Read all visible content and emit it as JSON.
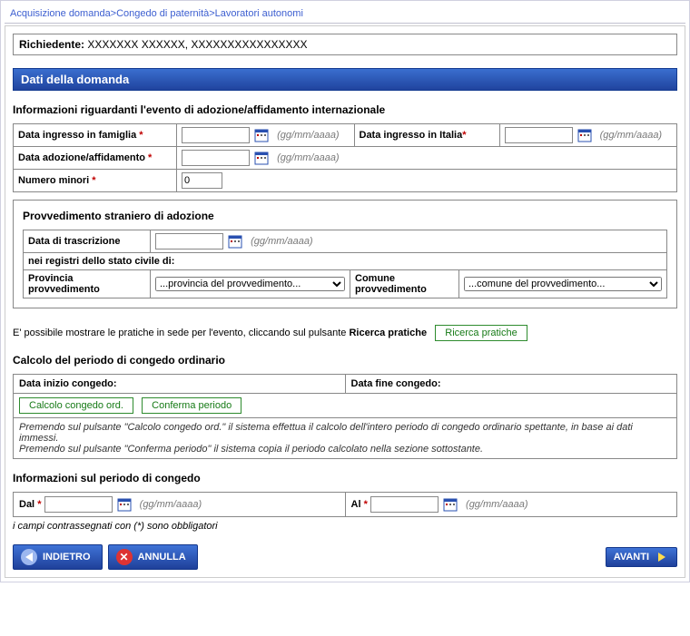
{
  "breadcrumb": "Acquisizione domanda>Congedo di paternità>Lavoratori autonomi",
  "richiedente": {
    "label": "Richiedente:",
    "value": "XXXXXXX XXXXXX, XXXXXXXXXXXXXXXX"
  },
  "section_title": "Dati della domanda",
  "evento": {
    "heading": "Informazioni riguardanti l'evento di adozione/affidamento internazionale",
    "row1": {
      "lbl_ingresso_famiglia": "Data ingresso in famiglia",
      "lbl_ingresso_italia": "Data ingresso in Italia"
    },
    "row2": {
      "lbl_adozione": "Data adozione/affidamento"
    },
    "row3": {
      "lbl_numero": "Numero minori",
      "value": "0"
    },
    "hint": "(gg/mm/aaaa)"
  },
  "provv": {
    "heading": "Provvedimento straniero di adozione",
    "lbl_trascrizione": "Data di trascrizione",
    "lbl_registri": "nei registri dello stato civile di:",
    "lbl_provincia": "Provincia provvedimento",
    "sel_provincia": "...provincia del provvedimento...",
    "lbl_comune": "Comune provvedimento",
    "sel_comune": "...comune del provvedimento..."
  },
  "ricerca": {
    "text_a": "E' possibile mostrare le pratiche in sede per l'evento, cliccando sul pulsante ",
    "text_b": "Ricerca pratiche",
    "btn": "Ricerca pratiche"
  },
  "calcolo": {
    "heading": "Calcolo del periodo di congedo ordinario",
    "lbl_inizio": "Data inizio congedo:",
    "lbl_fine": "Data fine congedo:",
    "btn_calcolo": "Calcolo congedo ord.",
    "btn_conferma": "Conferma periodo",
    "note1": "Premendo sul pulsante \"Calcolo congedo ord.\" il sistema effettua il calcolo dell'intero periodo di congedo ordinario spettante, in base ai dati immessi.",
    "note2": "Premendo sul pulsante \"Conferma periodo\" il sistema copia il periodo calcolato nella sezione sottostante."
  },
  "periodo": {
    "heading": "Informazioni sul periodo di congedo",
    "lbl_dal": "Dal",
    "lbl_al": "Al"
  },
  "obblig": "i campi contrassegnati con (*) sono obbligatori",
  "nav": {
    "indietro": "INDIETRO",
    "annulla": "ANNULLA",
    "avanti": "AVANTI"
  }
}
